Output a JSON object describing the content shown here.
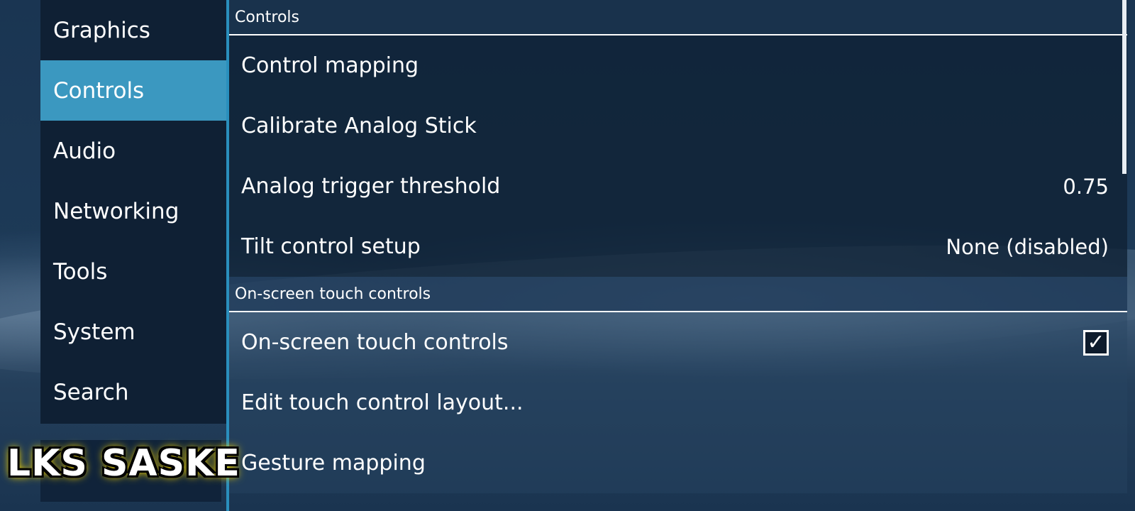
{
  "sidebar": {
    "items": [
      {
        "label": "Graphics",
        "active": false
      },
      {
        "label": "Controls",
        "active": true
      },
      {
        "label": "Audio",
        "active": false
      },
      {
        "label": "Networking",
        "active": false
      },
      {
        "label": "Tools",
        "active": false
      },
      {
        "label": "System",
        "active": false
      },
      {
        "label": "Search",
        "active": false
      }
    ]
  },
  "sections": [
    {
      "header": "Controls",
      "rows": [
        {
          "label": "Control mapping",
          "value": ""
        },
        {
          "label": "Calibrate Analog Stick",
          "value": ""
        },
        {
          "label": "Analog trigger threshold",
          "value": "0.75"
        },
        {
          "label": "Tilt control setup",
          "value": "None (disabled)"
        }
      ]
    },
    {
      "header": "On-screen touch controls",
      "rows": [
        {
          "label": "On-screen touch controls",
          "checked": true
        },
        {
          "label": "Edit touch control layout...",
          "value": ""
        },
        {
          "label": "Gesture mapping",
          "value": ""
        }
      ]
    }
  ],
  "checkbox_glyph": "✓",
  "watermark": "LKS SASKE",
  "colors": {
    "accent": "#3b98c0",
    "divider": "#2a8fbd",
    "sidebar_bg": "#0f2034",
    "watermark_glow": "#e6c800"
  }
}
